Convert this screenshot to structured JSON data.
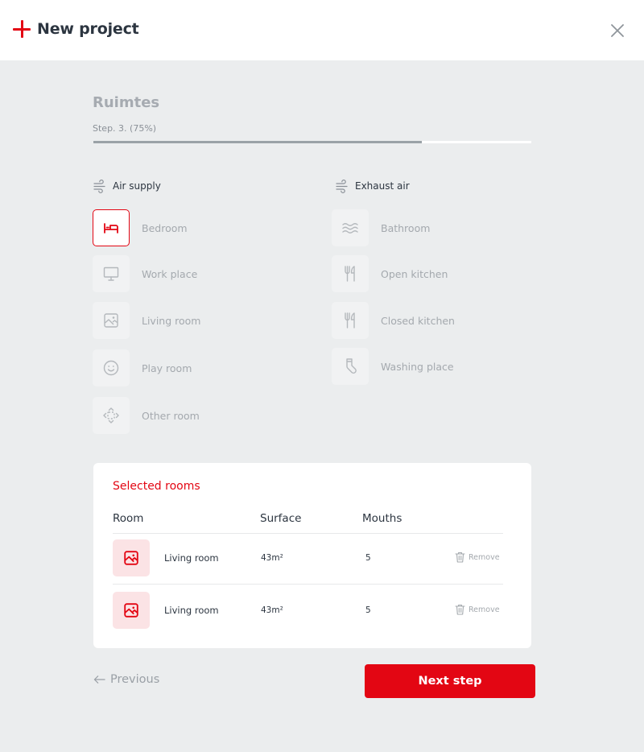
{
  "header": {
    "title": "New project",
    "plus_icon": "plus-icon",
    "close_icon": "close-icon"
  },
  "section": {
    "title": "Ruimtes",
    "step_label": "Step. 3. (75%)",
    "progress": 0.75
  },
  "air_supply": {
    "label": "Air supply",
    "icon": "airflow-icon",
    "rooms": [
      {
        "label": "Bedroom",
        "icon": "bed-icon",
        "selected": true
      },
      {
        "label": "Work place",
        "icon": "monitor-icon",
        "selected": false
      },
      {
        "label": "Living room",
        "icon": "picture-icon",
        "selected": false
      },
      {
        "label": "Play room",
        "icon": "smiley-icon",
        "selected": false
      },
      {
        "label": "Other room",
        "icon": "expand-icon",
        "selected": false
      }
    ]
  },
  "exhaust_air": {
    "label": "Exhaust air",
    "icon": "airflow-icon",
    "rooms": [
      {
        "label": "Bathroom",
        "icon": "water-waves-icon"
      },
      {
        "label": "Open kitchen",
        "icon": "cutlery-icon"
      },
      {
        "label": "Closed kitchen",
        "icon": "cutlery-icon"
      },
      {
        "label": "Washing place",
        "icon": "sock-icon"
      }
    ]
  },
  "selected_rooms": {
    "title": "Selected rooms",
    "columns": [
      "Room",
      "Surface",
      "Mouths"
    ],
    "rows": [
      {
        "icon": "picture-icon",
        "room": "Living room",
        "surface": "43m²",
        "mouths": "5",
        "remove": "Remove"
      },
      {
        "icon": "picture-icon",
        "room": "Living room",
        "surface": "43m²",
        "mouths": "5",
        "remove": "Remove"
      }
    ]
  },
  "footer": {
    "previous": "Previous",
    "next": "Next step"
  },
  "colors": {
    "accent": "#e30613",
    "background": "#ebedee",
    "muted": "#a4a9ae",
    "text": "#2c3540"
  }
}
